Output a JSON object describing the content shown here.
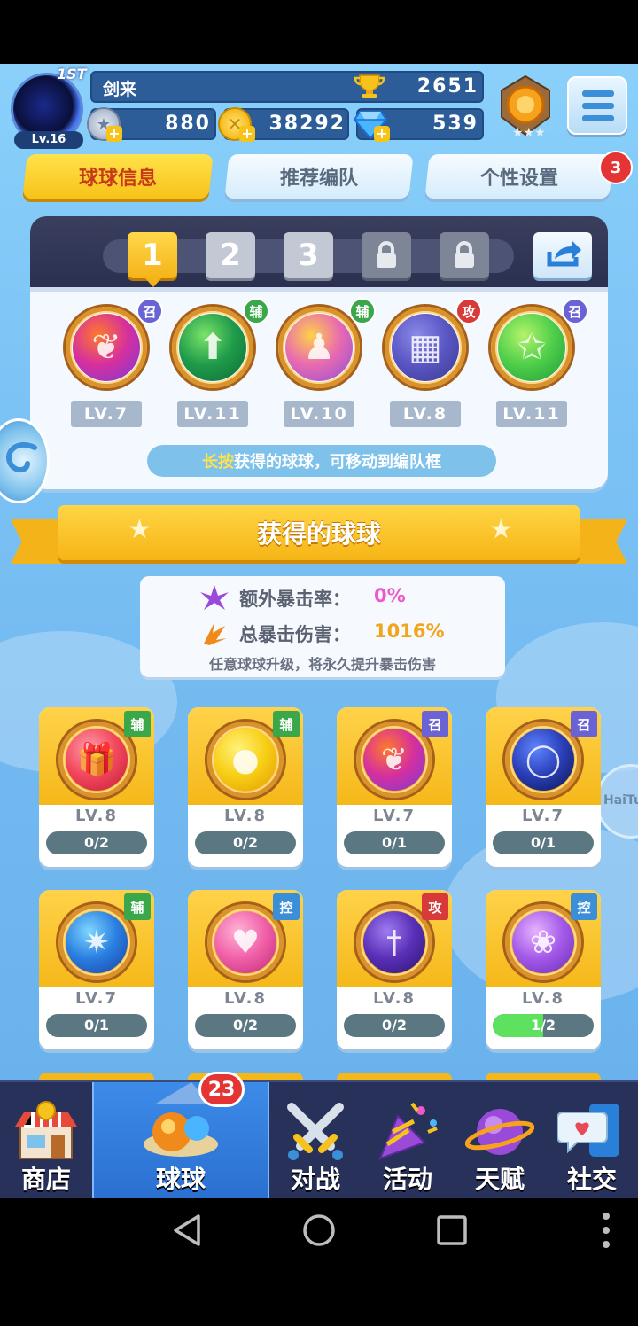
{
  "player": {
    "name": "剑来",
    "level": "Lv.16",
    "rank_tag": "1ST",
    "trophies": "2651",
    "silver": "880",
    "coins": "38292",
    "gems": "539"
  },
  "tabs": [
    {
      "label": "球球信息",
      "active": true
    },
    {
      "label": "推荐编队",
      "active": false
    },
    {
      "label": "个性设置",
      "active": false,
      "badge": "3"
    }
  ],
  "team": {
    "slots": [
      "1",
      "2",
      "3"
    ],
    "members": [
      {
        "type": "召",
        "type_color": "#6a63d6",
        "level": "LV.7",
        "colors": [
          "#ff7a2a",
          "#d62f9e",
          "#7a3bd6"
        ],
        "symbol": "phoenix"
      },
      {
        "type": "辅",
        "type_color": "#3aa84a",
        "level": "LV.11",
        "colors": [
          "#7be36a",
          "#1f9b4a",
          "#0c6b37"
        ],
        "symbol": "arrow-star"
      },
      {
        "type": "辅",
        "type_color": "#3aa84a",
        "level": "LV.10",
        "colors": [
          "#ffd04a",
          "#e86ab0",
          "#8d4fd8"
        ],
        "symbol": "figures"
      },
      {
        "type": "攻",
        "type_color": "#d83a3a",
        "level": "LV.8",
        "colors": [
          "#8b89e8",
          "#5a56c4",
          "#3c3a8e"
        ],
        "symbol": "pixel"
      },
      {
        "type": "召",
        "type_color": "#6a63d6",
        "level": "LV.11",
        "colors": [
          "#b4f36a",
          "#4fcf4a",
          "#1f9b3a"
        ],
        "symbol": "star"
      }
    ],
    "hint_key": "长按",
    "hint_rest": "获得的球球，可移动到编队框"
  },
  "section_title": "获得的球球",
  "crit": {
    "extra_label": "额外暴击率：",
    "extra_value": "0%",
    "total_label": "总暴击伤害：",
    "total_value": "1016%",
    "note": "任意球球升级，将永久提升暴击伤害"
  },
  "cards": [
    {
      "type": "辅",
      "type_color": "#3aa84a",
      "level": "LV.8",
      "progress": "0/2",
      "fill": 0,
      "colors": [
        "#ff9ba8",
        "#f2475d",
        "#c21c3b"
      ],
      "symbol": "gift"
    },
    {
      "type": "辅",
      "type_color": "#3aa84a",
      "level": "LV.8",
      "progress": "0/2",
      "fill": 0,
      "colors": [
        "#fff27a",
        "#f8cf16",
        "#e29b00"
      ],
      "symbol": "piggy"
    },
    {
      "type": "召",
      "type_color": "#6a63d6",
      "level": "LV.7",
      "progress": "0/1",
      "fill": 0,
      "colors": [
        "#ff7a2a",
        "#d62f9e",
        "#7a3bd6"
      ],
      "symbol": "phoenix"
    },
    {
      "type": "召",
      "type_color": "#6a63d6",
      "level": "LV.7",
      "progress": "0/1",
      "fill": 0,
      "colors": [
        "#5f85ff",
        "#2a3fb8",
        "#0c1550"
      ],
      "symbol": "void"
    },
    {
      "type": "辅",
      "type_color": "#3aa84a",
      "level": "LV.7",
      "progress": "0/1",
      "fill": 0,
      "colors": [
        "#7fd6ff",
        "#2a7fe0",
        "#1a3fa8"
      ],
      "symbol": "crystal"
    },
    {
      "type": "控",
      "type_color": "#3a8fd8",
      "level": "LV.8",
      "progress": "0/2",
      "fill": 0,
      "colors": [
        "#ffb3d6",
        "#f061a8",
        "#c0287a"
      ],
      "symbol": "heart"
    },
    {
      "type": "攻",
      "type_color": "#d83a3a",
      "level": "LV.8",
      "progress": "0/2",
      "fill": 0,
      "colors": [
        "#9e7cf0",
        "#5a2fb8",
        "#2c1570"
      ],
      "symbol": "sword"
    },
    {
      "type": "控",
      "type_color": "#3a8fd8",
      "level": "LV.8",
      "progress": "1/2",
      "fill": 0.5,
      "colors": [
        "#e6b3ff",
        "#a45ae8",
        "#6a2bb8"
      ],
      "symbol": "butterfly"
    }
  ],
  "nav": [
    {
      "label": "商店",
      "active": false
    },
    {
      "label": "球球",
      "active": true,
      "badge": "23"
    },
    {
      "label": "对战",
      "active": false
    },
    {
      "label": "活动",
      "active": false
    },
    {
      "label": "天赋",
      "active": false
    },
    {
      "label": "社交",
      "active": false
    }
  ],
  "floating_label": "HaiTu"
}
